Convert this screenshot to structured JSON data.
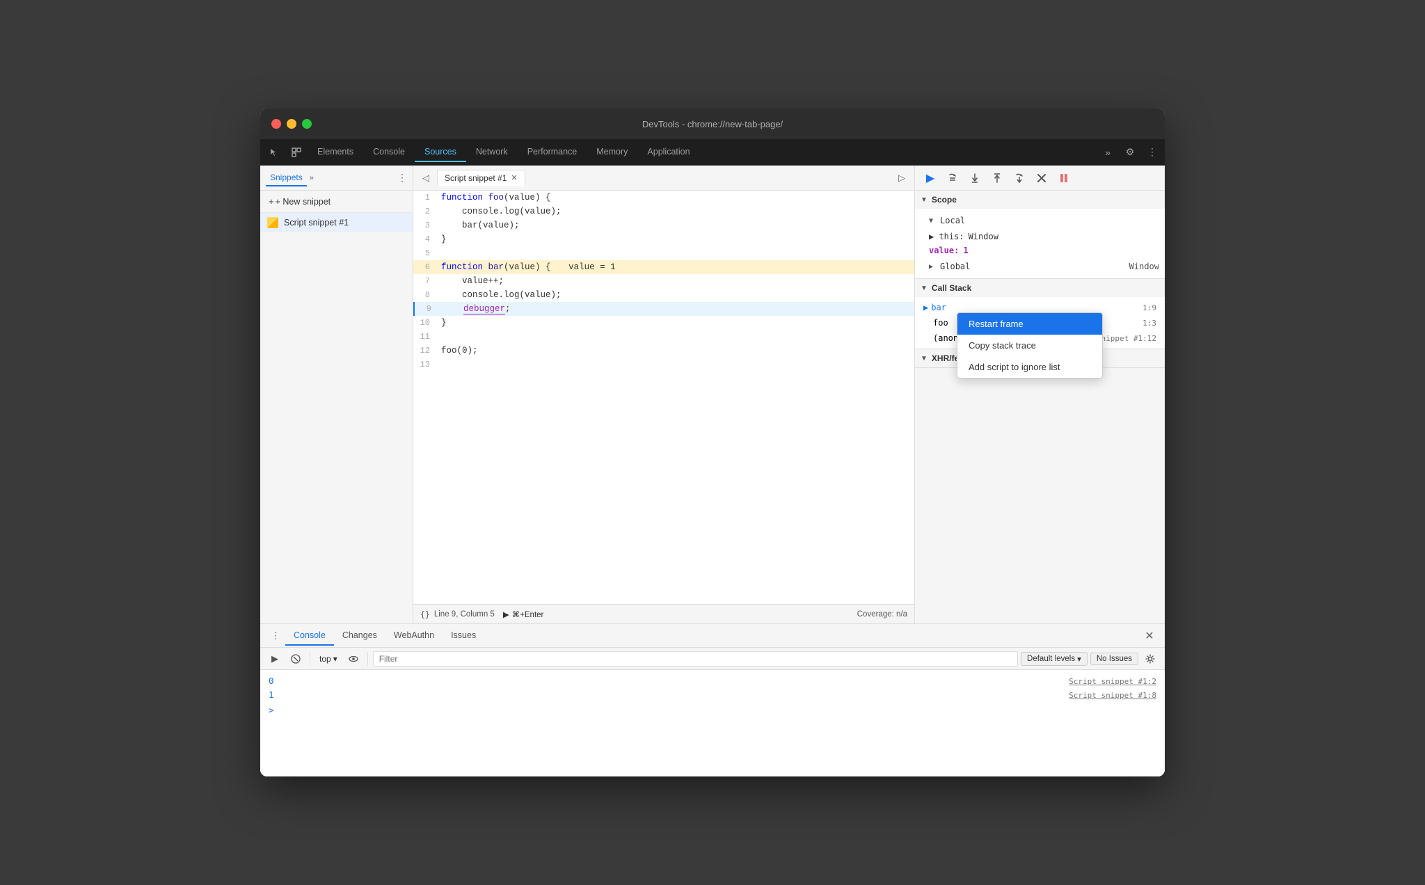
{
  "window": {
    "title": "DevTools - chrome://new-tab-page/"
  },
  "main_tabs": {
    "items": [
      {
        "label": "Elements",
        "active": false
      },
      {
        "label": "Console",
        "active": false
      },
      {
        "label": "Sources",
        "active": true
      },
      {
        "label": "Network",
        "active": false
      },
      {
        "label": "Performance",
        "active": false
      },
      {
        "label": "Memory",
        "active": false
      },
      {
        "label": "Application",
        "active": false
      }
    ],
    "more_label": "»",
    "settings_icon": "⚙",
    "dots_icon": "⋮"
  },
  "sidebar": {
    "tab_label": "Snippets",
    "new_snippet_label": "+ New snippet",
    "snippet_item_label": "Script snippet #1"
  },
  "editor": {
    "tab_label": "Script snippet #1",
    "lines": [
      {
        "num": 1,
        "content": "function foo(value) {",
        "type": "normal"
      },
      {
        "num": 2,
        "content": "    console.log(value);",
        "type": "normal"
      },
      {
        "num": 3,
        "content": "    bar(value);",
        "type": "normal"
      },
      {
        "num": 4,
        "content": "}",
        "type": "normal"
      },
      {
        "num": 5,
        "content": "",
        "type": "normal"
      },
      {
        "num": 6,
        "content": "function bar(value) {",
        "type": "highlight",
        "highlight_text": "value = 1"
      },
      {
        "num": 7,
        "content": "    value++;",
        "type": "normal"
      },
      {
        "num": 8,
        "content": "    console.log(value);",
        "type": "normal"
      },
      {
        "num": 9,
        "content": "    debugger;",
        "type": "debugger"
      },
      {
        "num": 10,
        "content": "}",
        "type": "normal"
      },
      {
        "num": 11,
        "content": "",
        "type": "normal"
      },
      {
        "num": 12,
        "content": "foo(0);",
        "type": "normal"
      },
      {
        "num": 13,
        "content": "",
        "type": "normal"
      }
    ],
    "status_bar": {
      "format_btn": "{}",
      "position": "Line 9, Column 5",
      "run_label": "⌘+Enter",
      "coverage": "Coverage: n/a"
    }
  },
  "right_panel": {
    "debug_btns": [
      "▶",
      "↺",
      "↓",
      "↑",
      "⇥",
      "✎",
      "⏸"
    ],
    "scope": {
      "header": "Scope",
      "local_header": "Local",
      "local_items": [
        {
          "key": "▶ this:",
          "value": "Window",
          "type": "object"
        },
        {
          "key": "value:",
          "value": "1",
          "type": "number",
          "highlight": true
        }
      ],
      "global_header": "Global",
      "global_value": "Window"
    },
    "call_stack": {
      "header": "Call Stack",
      "items": [
        {
          "label": "bar",
          "loc": "1:9",
          "active": true
        },
        {
          "label": "foo",
          "loc": "1:3",
          "active": false
        },
        {
          "label": "(anon…",
          "loc": "",
          "active": false
        }
      ],
      "anon_source": "Script snippet #1:12"
    }
  },
  "context_menu": {
    "items": [
      {
        "label": "Restart frame",
        "highlighted": true
      },
      {
        "label": "Copy stack trace",
        "highlighted": false
      },
      {
        "label": "Add script to ignore list",
        "highlighted": false
      }
    ]
  },
  "bottom_panel": {
    "tabs": [
      {
        "label": "Console",
        "active": true
      },
      {
        "label": "Changes",
        "active": false
      },
      {
        "label": "WebAuthn",
        "active": false
      },
      {
        "label": "Issues",
        "active": false
      }
    ],
    "toolbar": {
      "execute_icon": "▶",
      "clear_icon": "🚫",
      "top_label": "top",
      "eye_icon": "👁",
      "filter_placeholder": "Filter",
      "default_levels": "Default levels",
      "no_issues": "No Issues"
    },
    "console_lines": [
      {
        "value": "0",
        "source": "Script snippet #1:2"
      },
      {
        "value": "1",
        "source": "Script snippet #1:8"
      }
    ],
    "prompt": ">"
  }
}
